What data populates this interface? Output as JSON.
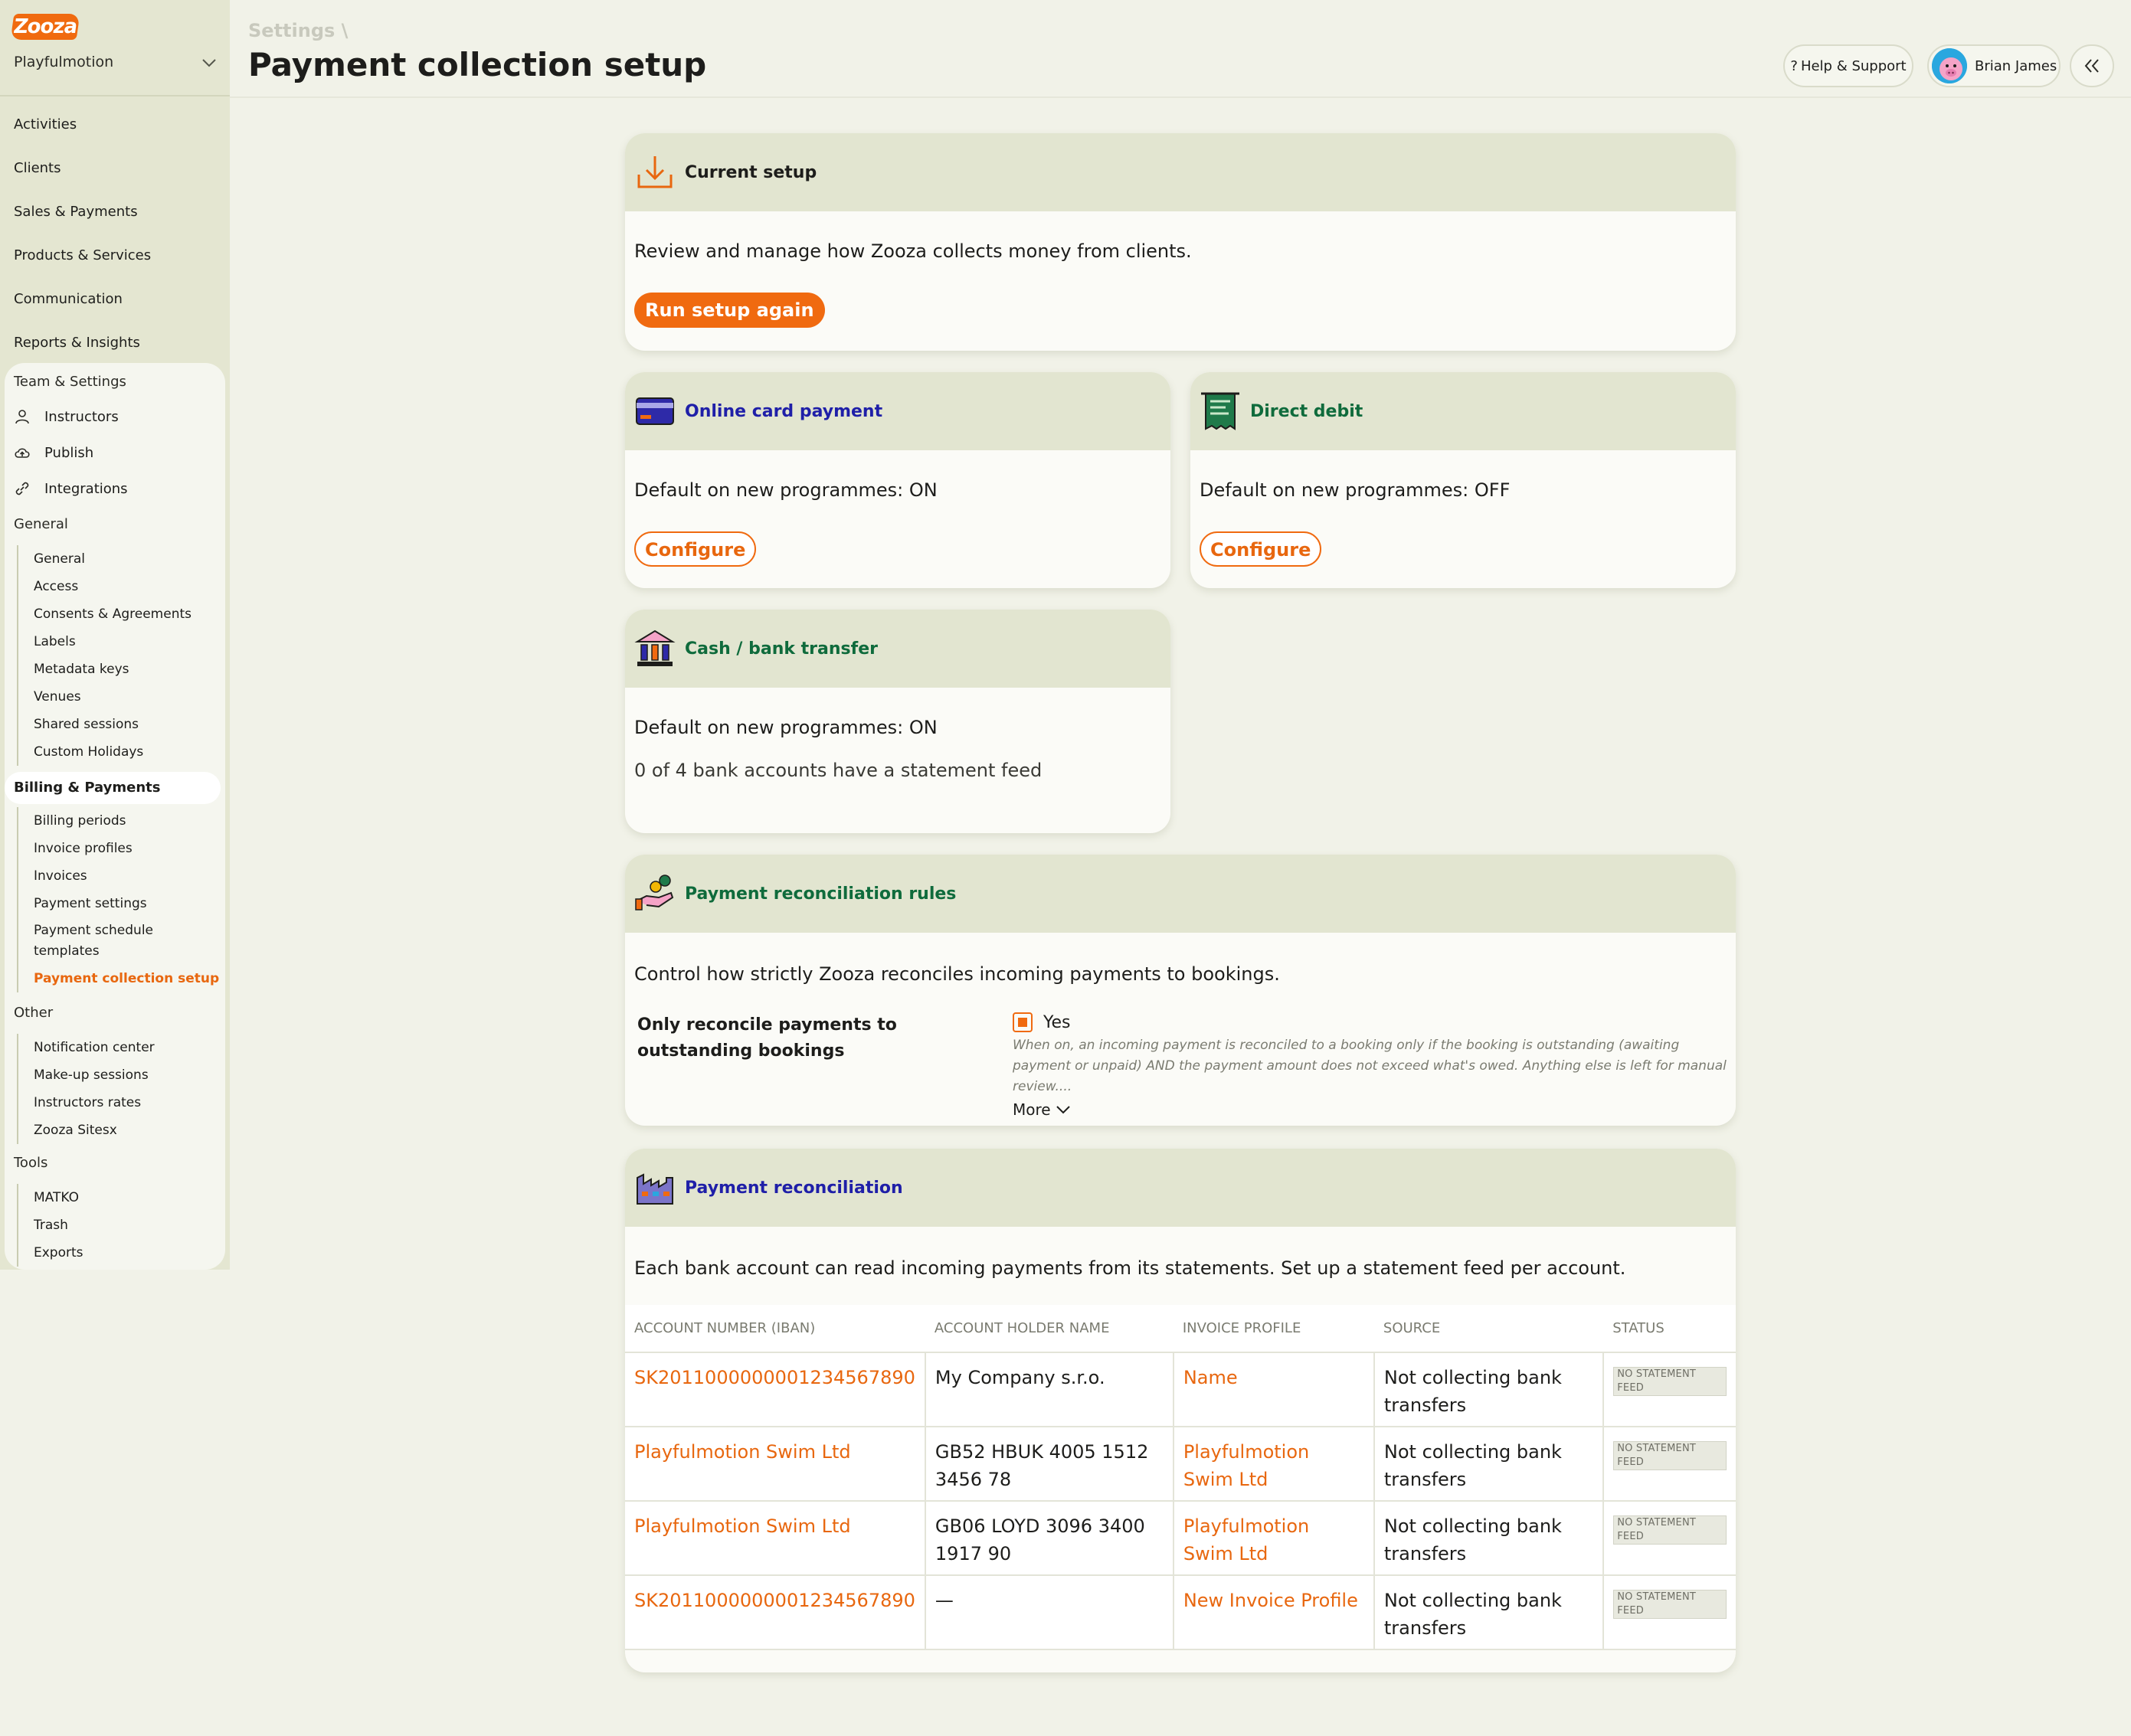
{
  "sidebar": {
    "logo_text": "Zooza",
    "org_name": "Playfulmotion",
    "nav": [
      "Activities",
      "Clients",
      "Sales & Payments",
      "Products & Services",
      "Communication",
      "Reports & Insights"
    ],
    "settings": {
      "heading": "Team & Settings",
      "team_items": [
        "Instructors",
        "Publish",
        "Integrations"
      ],
      "general_heading": "General",
      "general_items": [
        "General",
        "Access",
        "Consents & Agreements",
        "Labels",
        "Metadata keys",
        "Venues",
        "Shared sessions",
        "Custom Holidays"
      ],
      "billing_heading": "Billing & Payments",
      "billing_items": [
        "Billing periods",
        "Invoice profiles",
        "Invoices",
        "Payment settings",
        "Payment schedule templates",
        "Payment collection setup"
      ],
      "other_heading": "Other",
      "other_items": [
        "Notification center",
        "Make-up sessions",
        "Instructors rates",
        "Zooza Sitesx"
      ],
      "tools_heading": "Tools",
      "tools_items": [
        "MATKO",
        "Trash",
        "Exports"
      ]
    }
  },
  "header": {
    "breadcrumb": "Settings \\",
    "title": "Payment collection setup",
    "help_label": "Help & Support",
    "user_name": "Brian James"
  },
  "current_setup": {
    "title": "Current setup",
    "description": "Review and manage how Zooza collects money from clients.",
    "button": "Run setup again"
  },
  "online_card": {
    "title": "Online card payment",
    "status": "Default on new programmes: ON",
    "button": "Configure"
  },
  "direct_debit": {
    "title": "Direct debit",
    "status": "Default on new programmes: OFF",
    "button": "Configure"
  },
  "cash_bank": {
    "title": "Cash / bank transfer",
    "status": "Default on new programmes: ON",
    "feeds": "0 of 4 bank accounts have a statement feed"
  },
  "rules": {
    "title": "Payment reconciliation rules",
    "description": "Control how strictly Zooza reconciles incoming payments to bookings.",
    "rule_label": "Only reconcile payments to outstanding bookings",
    "checkbox_label": "Yes",
    "help_text": "When on, an incoming payment is reconciled to a booking only if the booking is outstanding (awaiting payment or unpaid) AND the payment amount does not exceed what's owed. Anything else is left for manual review....",
    "more_label": "More"
  },
  "reconciliation": {
    "title": "Payment reconciliation",
    "description": "Each bank account can read incoming payments from its statements. Set up a statement feed per account.",
    "columns": [
      "ACCOUNT NUMBER (IBAN)",
      "ACCOUNT HOLDER NAME",
      "INVOICE PROFILE",
      "SOURCE",
      "STATUS"
    ],
    "rows": [
      {
        "account": "SK2011000000001234567890",
        "holder": "My Company s.r.o.",
        "profile": "Name",
        "source": "Not collecting bank transfers",
        "status": "NO STATEMENT FEED"
      },
      {
        "account": "Playfulmotion Swim Ltd",
        "holder": "GB52 HBUK 4005 1512 3456 78",
        "profile": "Playfulmotion Swim Ltd",
        "source": "Not collecting bank transfers",
        "status": "NO STATEMENT FEED"
      },
      {
        "account": "Playfulmotion Swim Ltd",
        "holder": "GB06 LOYD 3096 3400 1917 90",
        "profile": "Playfulmotion Swim Ltd",
        "source": "Not collecting bank transfers",
        "status": "NO STATEMENT FEED"
      },
      {
        "account": "SK2011000000001234567890",
        "holder": "—",
        "profile": "New Invoice Profile",
        "source": "Not collecting bank transfers",
        "status": "NO STATEMENT FEED"
      }
    ]
  },
  "colors": {
    "accent": "#f06a10",
    "sidebar_bg": "#e4e6d1",
    "card_header_bg": "#e2e5d0",
    "title_blue": "#1f1fa8",
    "title_green": "#0f6b3c"
  }
}
